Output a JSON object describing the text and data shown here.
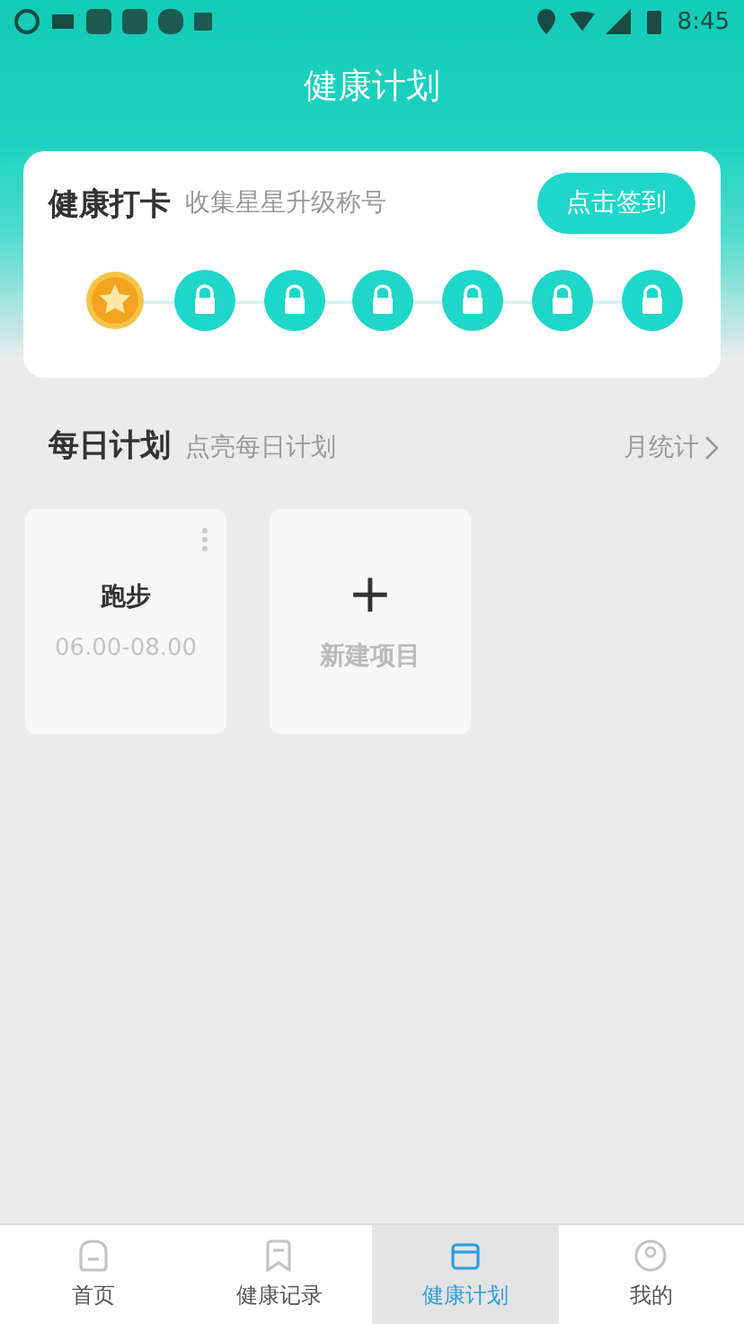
{
  "status_bar": {
    "time": "8:45"
  },
  "header": {
    "title": "健康计划"
  },
  "checkin": {
    "title": "健康打卡",
    "subtitle": "收集星星升级称号",
    "button": "点击签到",
    "steps": [
      {
        "unlocked": true
      },
      {
        "unlocked": false
      },
      {
        "unlocked": false
      },
      {
        "unlocked": false
      },
      {
        "unlocked": false
      },
      {
        "unlocked": false
      },
      {
        "unlocked": false
      }
    ]
  },
  "daily_plan": {
    "title": "每日计划",
    "subtitle": "点亮每日计划",
    "link": "月统计",
    "items": [
      {
        "kind": "plan",
        "name": "跑步",
        "time": "06.00-08.00"
      },
      {
        "kind": "add",
        "plus": "+",
        "name": "新建项目"
      }
    ]
  },
  "tabs": [
    {
      "label": "首页",
      "selected": false
    },
    {
      "label": "健康记录",
      "selected": false
    },
    {
      "label": "健康计划",
      "selected": true
    },
    {
      "label": "我的",
      "selected": false
    }
  ]
}
